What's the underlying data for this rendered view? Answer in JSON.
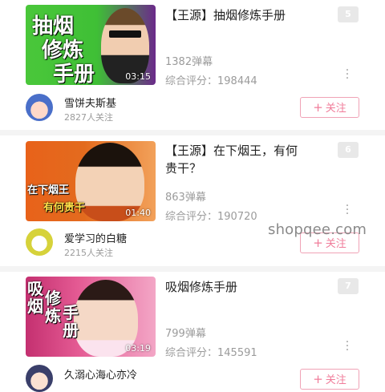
{
  "videos": [
    {
      "title": "【王源】抽烟修炼手册",
      "duration": "03:15",
      "danmu": "1382弹幕",
      "score": "综合评分：198444",
      "rank": "5",
      "overlay_lines": [
        "抽烟",
        "修炼",
        "手册"
      ],
      "uploader": {
        "name": "雪饼夫斯基",
        "followers": "2827人关注"
      },
      "follow_label": "关注",
      "follow_plus": "+",
      "more_icon": "more-vertical-icon"
    },
    {
      "title": "【王源】在下烟王，有何贵干？",
      "duration": "01:40",
      "danmu": "863弹幕",
      "score": "综合评分：190720",
      "rank": "6",
      "overlay_lines": [
        "在下烟王",
        "有何贵干"
      ],
      "uploader": {
        "name": "爱学习的白糖",
        "followers": "2215人关注"
      },
      "follow_label": "关注",
      "follow_plus": "+",
      "more_icon": "more-vertical-icon"
    },
    {
      "title": "吸烟修炼手册",
      "duration": "03:19",
      "danmu": "799弹幕",
      "score": "综合评分：145591",
      "rank": "7",
      "overlay_lines": [
        "吸烟",
        "修炼",
        "手册"
      ],
      "uploader": {
        "name": "久溺心海心亦冷",
        "followers": ""
      },
      "follow_label": "关注",
      "follow_plus": "+",
      "more_icon": "more-vertical-icon"
    }
  ],
  "watermark": "shopqee.com",
  "colors": {
    "accent_pink": "#f07c9a",
    "rank_badge": "#e8e8e8",
    "meta_gray": "#9b9b9b"
  }
}
